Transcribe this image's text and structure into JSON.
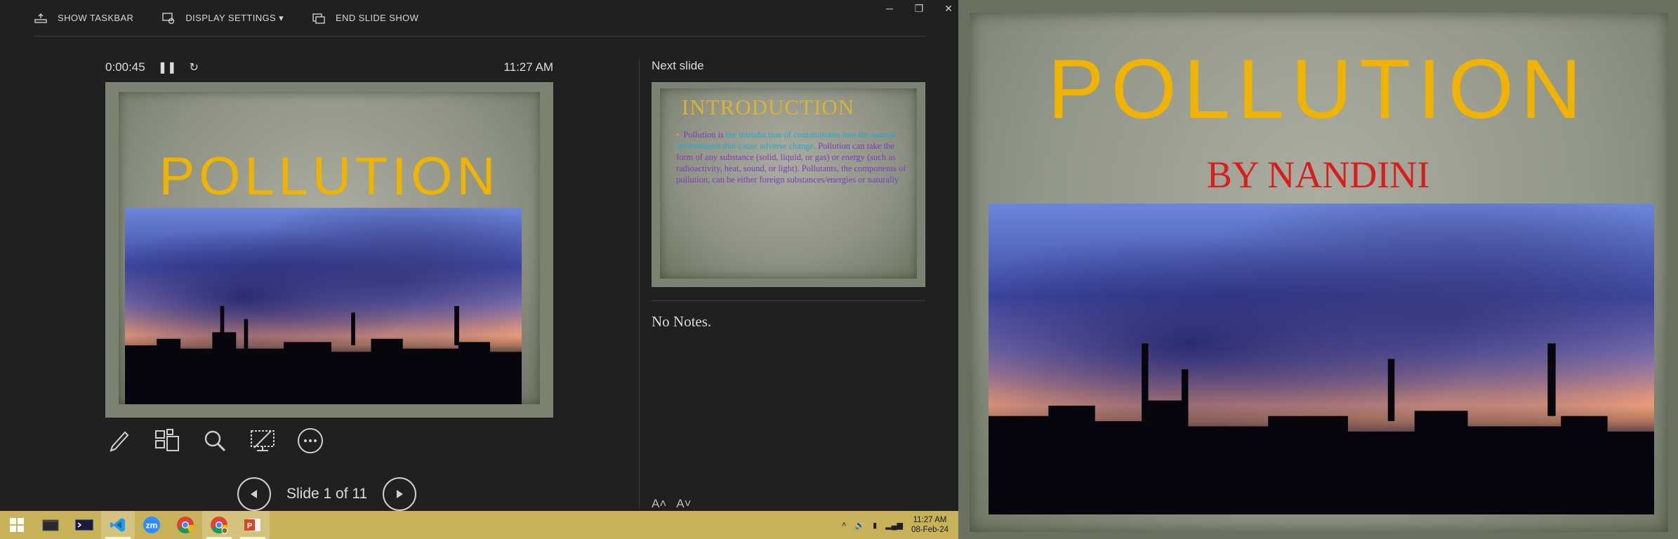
{
  "top_toolbar": {
    "show_taskbar": "SHOW TASKBAR",
    "display_settings": "DISPLAY SETTINGS ▾",
    "end_slide_show": "END SLIDE SHOW"
  },
  "presenter": {
    "elapsed_time": "0:00:45",
    "clock": "11:27 AM",
    "next_slide_label": "Next slide",
    "notes_text": "No Notes.",
    "slide_counter": "Slide 1 of 11"
  },
  "current_slide": {
    "title": "POLLUTION",
    "subtitle": "BY NANDINI"
  },
  "next_slide": {
    "title": "INTRODUCTION",
    "body_lead": "Pollution is",
    "body_highlight": "the introduction of contaminants into the natural environment that cause adverse change.",
    "body_rest": "Pollution can take the form of any substance (solid, liquid, or gas) or energy (such as radioactivity, heat, sound, or light). Pollutants, the components of pollution, can be either foreign substances/energies or naturally"
  },
  "taskbar": {
    "clock_time": "11:27 AM",
    "clock_date": "08-Feb-24",
    "apps": [
      "start-icon",
      "file-explorer-icon",
      "terminal-icon",
      "vscode-icon",
      "zoom-icon",
      "chrome-icon",
      "chrome-profile-icon",
      "powerpoint-icon"
    ]
  },
  "colors": {
    "title_yellow": "#f0b400",
    "subtitle_red": "#d91c1c",
    "intro_gold": "#d9b332",
    "body_purple": "#7a3cc0",
    "highlight_blue": "#1fa9d6",
    "taskbar": "#c7b25a"
  }
}
